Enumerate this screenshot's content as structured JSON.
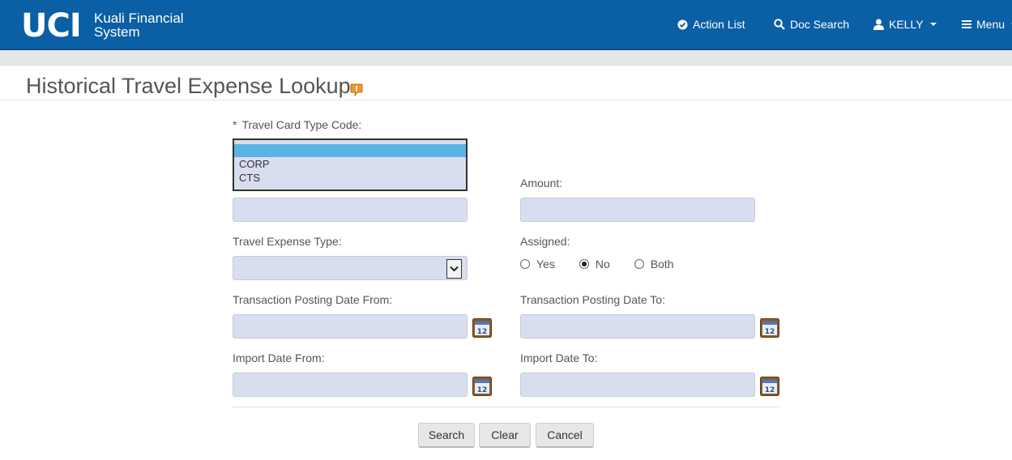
{
  "header": {
    "logo_text": "UCI",
    "app_name_line1": "Kuali Financial",
    "app_name_line2": "System",
    "nav": {
      "action_list": "Action List",
      "doc_search": "Doc Search",
      "user": "KELLY",
      "menu": "Menu"
    }
  },
  "page": {
    "title": "Historical Travel Expense Lookup"
  },
  "form": {
    "travel_card_type_code": {
      "required_mark": "*",
      "label": "Travel Card Type Code:",
      "options": [
        "",
        "CORP",
        "CTS"
      ],
      "selected_index": 0
    },
    "amount": {
      "label": "Amount:",
      "value": ""
    },
    "unlabeled_field": {
      "value": ""
    },
    "travel_expense_type": {
      "label": "Travel Expense Type:",
      "value": ""
    },
    "assigned": {
      "label": "Assigned:",
      "options": [
        "Yes",
        "No",
        "Both"
      ],
      "selected": "No"
    },
    "transaction_posting_date_from": {
      "label": "Transaction Posting Date From:",
      "value": ""
    },
    "transaction_posting_date_to": {
      "label": "Transaction Posting Date To:",
      "value": ""
    },
    "import_date_from": {
      "label": "Import Date From:",
      "value": ""
    },
    "import_date_to": {
      "label": "Import Date To:",
      "value": ""
    },
    "calendar_icon_text": "12"
  },
  "buttons": {
    "search": "Search",
    "clear": "Clear",
    "cancel": "Cancel"
  },
  "colors": {
    "header_bg": "#0a5fa5",
    "input_bg": "#d9deef",
    "list_selected": "#5ab3e6"
  },
  "icons": {
    "action_list": "check-circle-icon",
    "doc_search": "search-icon",
    "user": "user-icon",
    "menu": "hamburger-icon",
    "help": "help-icon",
    "calendar": "calendar-icon"
  }
}
